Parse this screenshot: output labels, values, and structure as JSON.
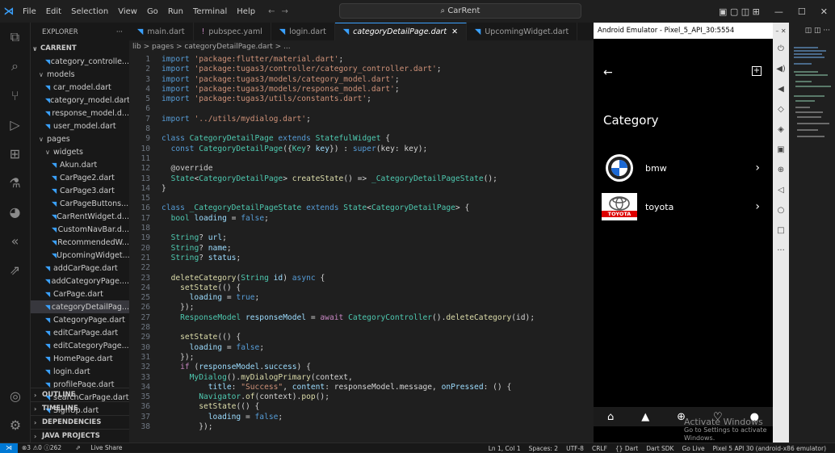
{
  "titlebar": {
    "menu": [
      "File",
      "Edit",
      "Selection",
      "View",
      "Go",
      "Run",
      "Terminal",
      "Help"
    ],
    "search": "CarRent",
    "icons": [
      "vscode-logo",
      "back-arrow-icon",
      "forward-arrow-icon",
      "layout-icon",
      "minimize-icon",
      "maximize-icon",
      "close-icon"
    ]
  },
  "explorer": {
    "header": "EXPLORER",
    "more": "···",
    "project": "CARRENT",
    "rows": [
      {
        "label": "category_controlle...",
        "indent": 2,
        "type": "file"
      },
      {
        "label": "models",
        "indent": 1,
        "type": "folder"
      },
      {
        "label": "car_model.dart",
        "indent": 2,
        "type": "file"
      },
      {
        "label": "category_model.dart",
        "indent": 2,
        "type": "file"
      },
      {
        "label": "response_model.d...",
        "indent": 2,
        "type": "file"
      },
      {
        "label": "user_model.dart",
        "indent": 2,
        "type": "file"
      },
      {
        "label": "pages",
        "indent": 1,
        "type": "folder"
      },
      {
        "label": "widgets",
        "indent": 2,
        "type": "folder"
      },
      {
        "label": "Akun.dart",
        "indent": 3,
        "type": "file"
      },
      {
        "label": "CarPage2.dart",
        "indent": 3,
        "type": "file"
      },
      {
        "label": "CarPage3.dart",
        "indent": 3,
        "type": "file"
      },
      {
        "label": "CarPageButtons...",
        "indent": 3,
        "type": "file"
      },
      {
        "label": "CarRentWidget.d...",
        "indent": 3,
        "type": "file"
      },
      {
        "label": "CustomNavBar.d...",
        "indent": 3,
        "type": "file"
      },
      {
        "label": "RecommendedW...",
        "indent": 3,
        "type": "file"
      },
      {
        "label": "UpcomingWidget...",
        "indent": 3,
        "type": "file"
      },
      {
        "label": "addCarPage.dart",
        "indent": 2,
        "type": "file"
      },
      {
        "label": "addCategoryPage....",
        "indent": 2,
        "type": "file"
      },
      {
        "label": "CarPage.dart",
        "indent": 2,
        "type": "file"
      },
      {
        "label": "categoryDetailPag...",
        "indent": 2,
        "type": "file",
        "selected": true
      },
      {
        "label": "CategoryPage.dart",
        "indent": 2,
        "type": "file"
      },
      {
        "label": "editCarPage.dart",
        "indent": 2,
        "type": "file"
      },
      {
        "label": "editCategoryPage...",
        "indent": 2,
        "type": "file"
      },
      {
        "label": "HomePage.dart",
        "indent": 2,
        "type": "file"
      },
      {
        "label": "login.dart",
        "indent": 2,
        "type": "file"
      },
      {
        "label": "profilePage.dart",
        "indent": 2,
        "type": "file"
      },
      {
        "label": "searchCarPage.dart",
        "indent": 2,
        "type": "file"
      },
      {
        "label": "SignUp.dart",
        "indent": 2,
        "type": "file"
      }
    ],
    "sections": [
      "OUTLINE",
      "TIMELINE",
      "DEPENDENCIES",
      "JAVA PROJECTS"
    ]
  },
  "tabs": [
    {
      "label": "main.dart",
      "icon": "dart"
    },
    {
      "label": "pubspec.yaml",
      "icon": "yaml"
    },
    {
      "label": "login.dart",
      "icon": "dart"
    },
    {
      "label": "categoryDetailPage.dart",
      "icon": "dart",
      "active": true
    },
    {
      "label": "UpcomingWidget.dart",
      "icon": "dart"
    }
  ],
  "breadcrumb": "lib > pages > categoryDetailPage.dart > ...",
  "code": [
    [
      [
        "kw",
        "import "
      ],
      [
        "st",
        "'package:flutter/material.dart'"
      ],
      [
        "pu",
        ";"
      ]
    ],
    [
      [
        "kw",
        "import "
      ],
      [
        "st",
        "'package:tugas3/controller/category_controller.dart'"
      ],
      [
        "pu",
        ";"
      ]
    ],
    [
      [
        "kw",
        "import "
      ],
      [
        "st",
        "'package:tugas3/models/category_model.dart'"
      ],
      [
        "pu",
        ";"
      ]
    ],
    [
      [
        "kw",
        "import "
      ],
      [
        "st",
        "'package:tugas3/models/response_model.dart'"
      ],
      [
        "pu",
        ";"
      ]
    ],
    [
      [
        "kw",
        "import "
      ],
      [
        "st",
        "'package:tugas3/utils/constants.dart'"
      ],
      [
        "pu",
        ";"
      ]
    ],
    [],
    [
      [
        "kw",
        "import "
      ],
      [
        "st",
        "'../utils/mydialog.dart'"
      ],
      [
        "pu",
        ";"
      ]
    ],
    [],
    [
      [
        "kw",
        "class "
      ],
      [
        "ty",
        "CategoryDetailPage "
      ],
      [
        "kw",
        "extends "
      ],
      [
        "ty",
        "StatefulWidget "
      ],
      [
        "pu",
        "{"
      ]
    ],
    [
      [
        "pu",
        "  "
      ],
      [
        "kw",
        "const "
      ],
      [
        "ty",
        "CategoryDetailPage"
      ],
      [
        "pu",
        "({"
      ],
      [
        "ty",
        "Key"
      ],
      [
        "pu",
        "? "
      ],
      [
        "va",
        "key"
      ],
      [
        "pu",
        "}) : "
      ],
      [
        "kw",
        "super"
      ],
      [
        "pu",
        "(key: key);"
      ]
    ],
    [],
    [
      [
        "an",
        "  @override"
      ]
    ],
    [
      [
        "pu",
        "  "
      ],
      [
        "ty",
        "State"
      ],
      [
        "pu",
        "<"
      ],
      [
        "ty",
        "CategoryDetailPage"
      ],
      [
        "pu",
        "> "
      ],
      [
        "fn",
        "createState"
      ],
      [
        "pu",
        "() => "
      ],
      [
        "ty",
        "_CategoryDetailPageState"
      ],
      [
        "pu",
        "();"
      ]
    ],
    [
      [
        "pu",
        "}"
      ]
    ],
    [],
    [
      [
        "kw",
        "class "
      ],
      [
        "ty",
        "_CategoryDetailPageState "
      ],
      [
        "kw",
        "extends "
      ],
      [
        "ty",
        "State"
      ],
      [
        "pu",
        "<"
      ],
      [
        "ty",
        "CategoryDetailPage"
      ],
      [
        "pu",
        "> {"
      ]
    ],
    [
      [
        "pu",
        "  "
      ],
      [
        "ty",
        "bool "
      ],
      [
        "va",
        "loading"
      ],
      [
        "pu",
        " = "
      ],
      [
        "kw",
        "false"
      ],
      [
        "pu",
        ";"
      ]
    ],
    [],
    [
      [
        "pu",
        "  "
      ],
      [
        "ty",
        "String"
      ],
      [
        "pu",
        "? "
      ],
      [
        "va",
        "url"
      ],
      [
        "pu",
        ";"
      ]
    ],
    [
      [
        "pu",
        "  "
      ],
      [
        "ty",
        "String"
      ],
      [
        "pu",
        "? "
      ],
      [
        "va",
        "name"
      ],
      [
        "pu",
        ";"
      ]
    ],
    [
      [
        "pu",
        "  "
      ],
      [
        "ty",
        "String"
      ],
      [
        "pu",
        "? "
      ],
      [
        "va",
        "status"
      ],
      [
        "pu",
        ";"
      ]
    ],
    [],
    [
      [
        "pu",
        "  "
      ],
      [
        "fn",
        "deleteCategory"
      ],
      [
        "pu",
        "("
      ],
      [
        "ty",
        "String "
      ],
      [
        "va",
        "id"
      ],
      [
        "pu",
        ") "
      ],
      [
        "kw",
        "async "
      ],
      [
        "pu",
        "{"
      ]
    ],
    [
      [
        "pu",
        "    "
      ],
      [
        "fn",
        "setState"
      ],
      [
        "pu",
        "(() {"
      ]
    ],
    [
      [
        "pu",
        "      "
      ],
      [
        "va",
        "loading"
      ],
      [
        "pu",
        " = "
      ],
      [
        "kw",
        "true"
      ],
      [
        "pu",
        ";"
      ]
    ],
    [
      [
        "pu",
        "    });"
      ]
    ],
    [
      [
        "pu",
        "    "
      ],
      [
        "ty",
        "ResponseModel "
      ],
      [
        "va",
        "responseModel"
      ],
      [
        "pu",
        " = "
      ],
      [
        "ctl",
        "await "
      ],
      [
        "ty",
        "CategoryController"
      ],
      [
        "pu",
        "()."
      ],
      [
        "fn",
        "deleteCategory"
      ],
      [
        "pu",
        "(id);"
      ]
    ],
    [],
    [
      [
        "pu",
        "    "
      ],
      [
        "fn",
        "setState"
      ],
      [
        "pu",
        "(() {"
      ]
    ],
    [
      [
        "pu",
        "      "
      ],
      [
        "va",
        "loading"
      ],
      [
        "pu",
        " = "
      ],
      [
        "kw",
        "false"
      ],
      [
        "pu",
        ";"
      ]
    ],
    [
      [
        "pu",
        "    });"
      ]
    ],
    [
      [
        "pu",
        "    "
      ],
      [
        "ctl",
        "if "
      ],
      [
        "pu",
        "("
      ],
      [
        "va",
        "responseModel"
      ],
      [
        "pu",
        "."
      ],
      [
        "va",
        "success"
      ],
      [
        "pu",
        ") {"
      ]
    ],
    [
      [
        "pu",
        "      "
      ],
      [
        "ty",
        "MyDialog"
      ],
      [
        "pu",
        "()."
      ],
      [
        "fn",
        "myDialogPrimary"
      ],
      [
        "pu",
        "(context,"
      ]
    ],
    [
      [
        "pu",
        "          "
      ],
      [
        "va",
        "title"
      ],
      [
        "pu",
        ": "
      ],
      [
        "st",
        "\"Success\""
      ],
      [
        "pu",
        ", "
      ],
      [
        "va",
        "content"
      ],
      [
        "pu",
        ": responseModel.message, "
      ],
      [
        "va",
        "onPressed"
      ],
      [
        "pu",
        ": () {"
      ]
    ],
    [
      [
        "pu",
        "        "
      ],
      [
        "ty",
        "Navigator"
      ],
      [
        "pu",
        "."
      ],
      [
        "fn",
        "of"
      ],
      [
        "pu",
        "(context)."
      ],
      [
        "fn",
        "pop"
      ],
      [
        "pu",
        "();"
      ]
    ],
    [
      [
        "pu",
        "        "
      ],
      [
        "fn",
        "setState"
      ],
      [
        "pu",
        "(() {"
      ]
    ],
    [
      [
        "pu",
        "          "
      ],
      [
        "va",
        "loading"
      ],
      [
        "pu",
        " = "
      ],
      [
        "kw",
        "false"
      ],
      [
        "pu",
        ";"
      ]
    ],
    [
      [
        "pu",
        "        });"
      ]
    ]
  ],
  "emulator": {
    "title": "Android Emulator - Pixel_5_API_30:5554",
    "page_title": "Category",
    "items": [
      {
        "name": "bmw",
        "logo": "bmw-logo"
      },
      {
        "name": "toyota",
        "logo": "toyota-logo",
        "logo_text": "TOYOTA"
      }
    ],
    "nav_icons": [
      "home-icon",
      "category-icon",
      "add-circle-icon",
      "heart-icon",
      "profile-icon"
    ],
    "watermark_title": "Activate Windows",
    "watermark_sub": "Go to Settings to activate Windows.",
    "side_controls": [
      "power-icon",
      "volume-up-icon",
      "volume-down-icon",
      "rotate-left-icon",
      "rotate-right-icon",
      "camera-icon",
      "zoom-icon",
      "back-icon",
      "home-circle-icon",
      "overview-icon",
      "more-icon"
    ]
  },
  "statusbar": {
    "left": "⊗3 ⚠0 ⓘ262",
    "live_share": "Live Share",
    "right": [
      "Ln 1, Col 1",
      "Spaces: 2",
      "UTF-8",
      "CRLF",
      "{} Dart",
      "Dart SDK",
      "Go Live",
      "Pixel 5 API 30 (android-x86 emulator)"
    ]
  }
}
